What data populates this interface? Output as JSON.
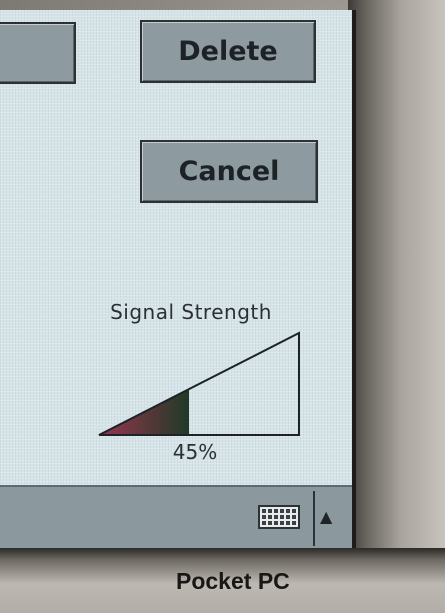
{
  "buttons": {
    "left_partial": "",
    "delete": "Delete",
    "cancel": "Cancel"
  },
  "signal": {
    "label": "Signal Strength",
    "percent_text": "45%",
    "level": 0.45
  },
  "taskbar": {
    "keyboard_icon": "keyboard-icon",
    "arrow": "▲"
  },
  "device": {
    "brand": "Pocket PC"
  },
  "colors": {
    "screen": "#d6e4e8",
    "button": "#8d9aa0",
    "signal_fill_start": "#9a3550",
    "signal_fill_end": "#1f3a26"
  }
}
